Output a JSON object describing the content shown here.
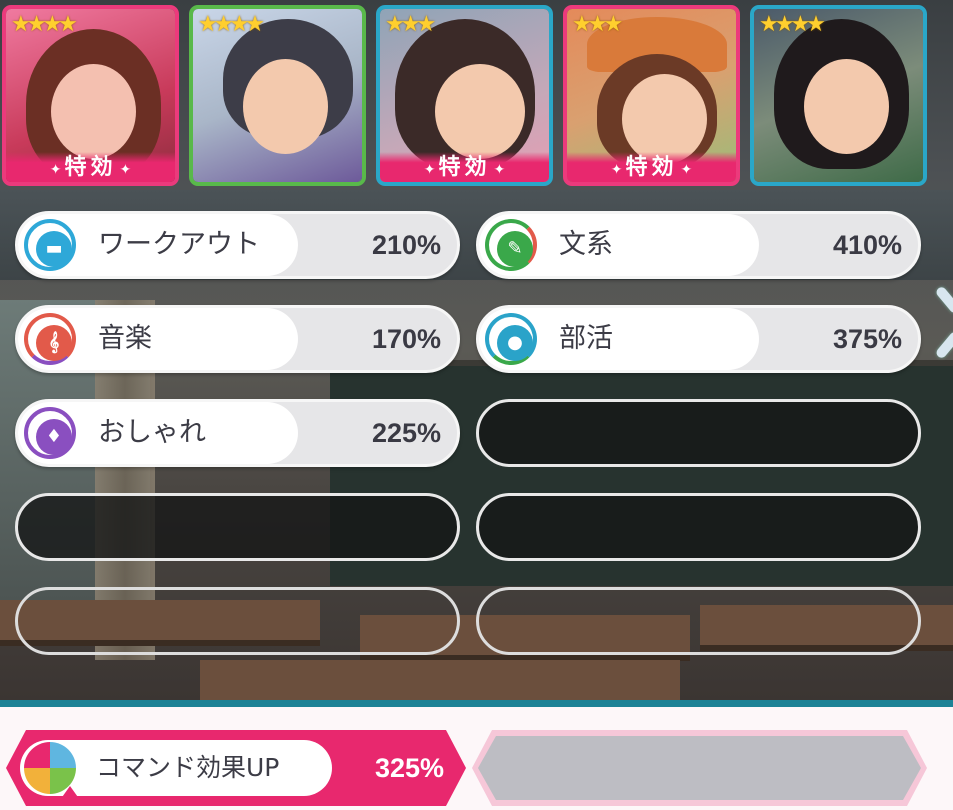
{
  "cards": [
    {
      "stars": "★★★★",
      "ribbon": "特効",
      "frame": "pink"
    },
    {
      "stars": "★★★★",
      "ribbon": "",
      "frame": "green"
    },
    {
      "stars": "★★★",
      "ribbon": "特効",
      "frame": "teal"
    },
    {
      "stars": "★★★",
      "ribbon": "特効",
      "frame": "pink"
    },
    {
      "stars": "★★★★",
      "ribbon": "",
      "frame": "teal"
    }
  ],
  "stats": [
    {
      "name": "ワークアウト",
      "percent": "210%",
      "icon": "dumbbell-icon",
      "color": "#2ea8d8"
    },
    {
      "name": "文系",
      "percent": "410%",
      "icon": "pen-icon",
      "color": "#3aa84a"
    },
    {
      "name": "音楽",
      "percent": "170%",
      "icon": "treble-clef-icon",
      "color": "#e25a4a"
    },
    {
      "name": "部活",
      "percent": "375%",
      "icon": "ball-icon",
      "color": "#2aa3c9"
    },
    {
      "name": "おしゃれ",
      "percent": "225%",
      "icon": "shirt-icon",
      "color": "#8a4fc0"
    }
  ],
  "command": {
    "name": "コマンド効果UP",
    "percent": "325%",
    "icon": "command-up-icon"
  },
  "colors": {
    "accent": "#e8286e",
    "teal": "#1e8296"
  }
}
